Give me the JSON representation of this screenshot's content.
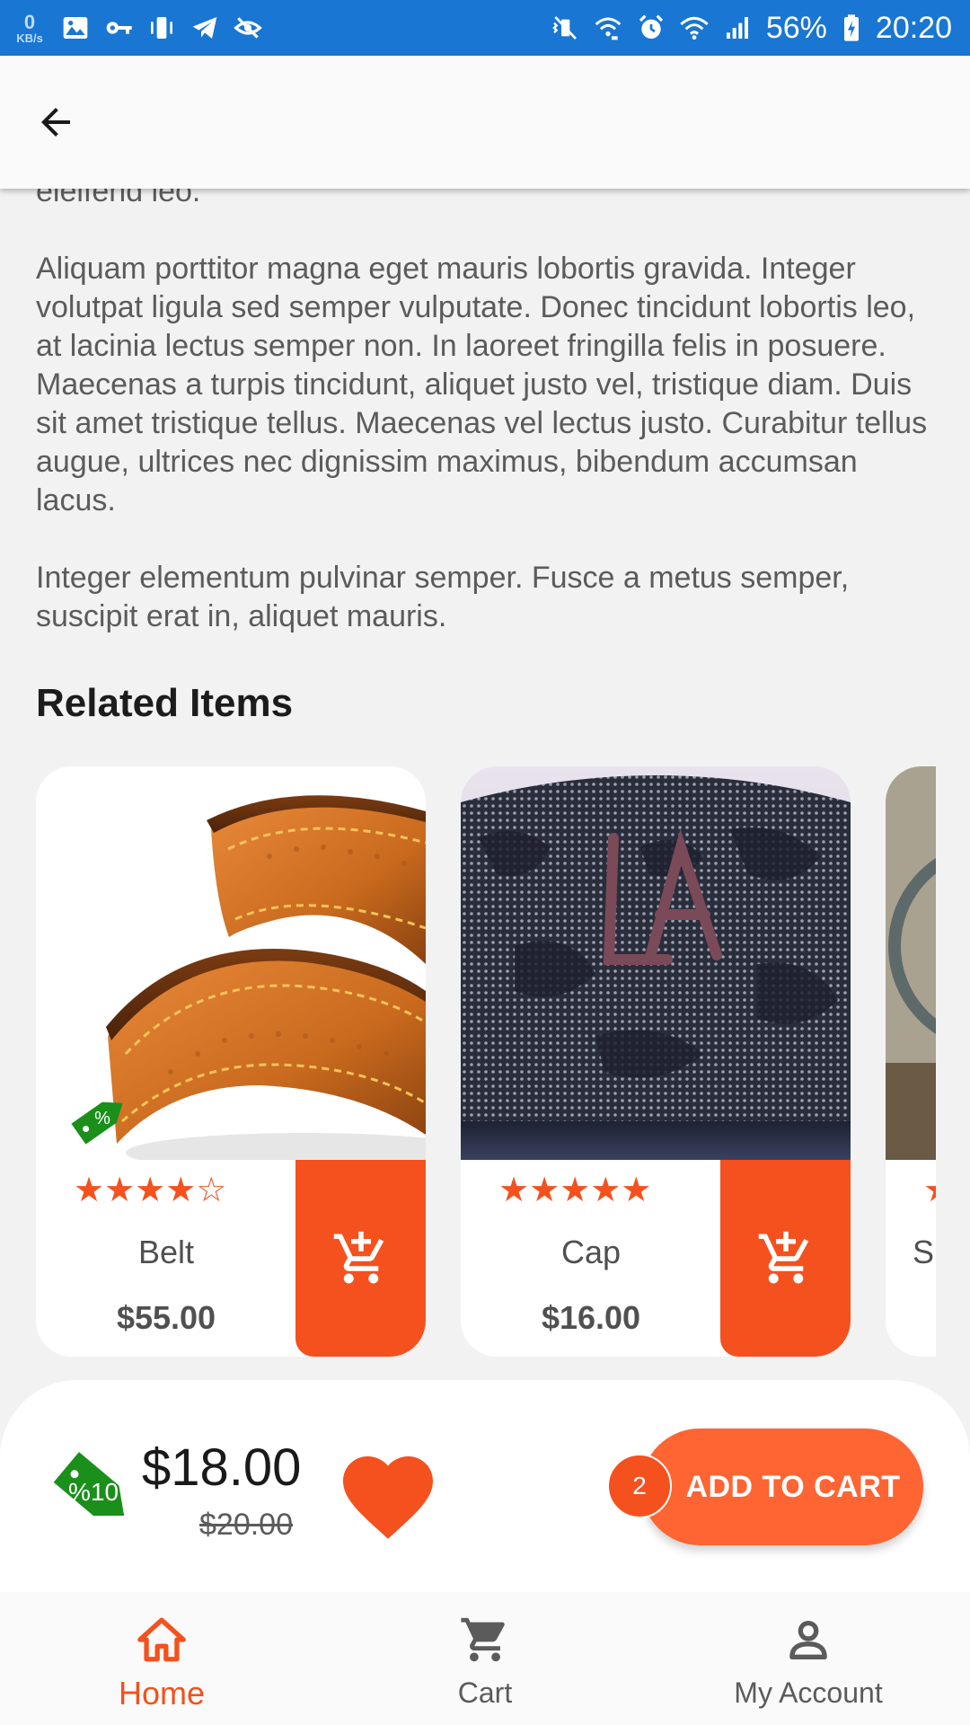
{
  "status_bar": {
    "net_speed_value": "0",
    "net_speed_unit": "KB/s",
    "battery": "56%",
    "time": "20:20",
    "left_icons": [
      "gallery-icon",
      "key-icon",
      "vibrate-icon",
      "telegram-icon",
      "eye-slash-icon"
    ],
    "right_icons": [
      "mute-icon",
      "wifi-call-icon",
      "alarm-icon",
      "wifi-icon",
      "signal-icon",
      "battery-icon"
    ]
  },
  "app_bar": {
    "back_icon": "arrow-back-icon"
  },
  "description": {
    "fragment": "eleifend leo.",
    "paragraph_1": "Aliquam porttitor magna eget mauris lobortis gravida. Integer volutpat ligula sed semper vulputate. Donec tincidunt lobortis leo, at lacinia lectus semper non. In laoreet fringilla felis in posuere. Maecenas a turpis tincidunt, aliquet justo vel, tristique diam. Duis sit amet tristique tellus. Maecenas vel lectus justo. Curabitur tellus augue, ultrices nec dignissim maximus, bibendum accumsan lacus.",
    "paragraph_2": "Integer elementum pulvinar semper. Fusce a metus semper, suscipit erat in, aliquet mauris."
  },
  "related": {
    "title": "Related Items",
    "items": [
      {
        "name": "Belt",
        "price": "$55.00",
        "rating": 4,
        "max_rating": 5,
        "stars": "★★★★☆",
        "discount_tag": "%"
      },
      {
        "name": "Cap",
        "price": "$16.00",
        "rating": 5,
        "max_rating": 5,
        "stars": "★★★★★"
      },
      {
        "name": "S",
        "stars": "★"
      }
    ]
  },
  "purchase_bar": {
    "discount_label": "%10",
    "price": "$18.00",
    "old_price": "$20.00",
    "add_to_cart_label": "ADD TO CART",
    "cart_count": "2"
  },
  "bottom_nav": {
    "items": [
      {
        "label": "Home",
        "icon": "home-icon",
        "active": true
      },
      {
        "label": "Cart",
        "icon": "cart-icon",
        "active": false
      },
      {
        "label": "My Account",
        "icon": "account-icon",
        "active": false
      }
    ]
  },
  "colors": {
    "accent": "#f4511e",
    "status_bar": "#1976d2",
    "tag_green": "#1a8f1a",
    "background": "#f2f2f2"
  }
}
